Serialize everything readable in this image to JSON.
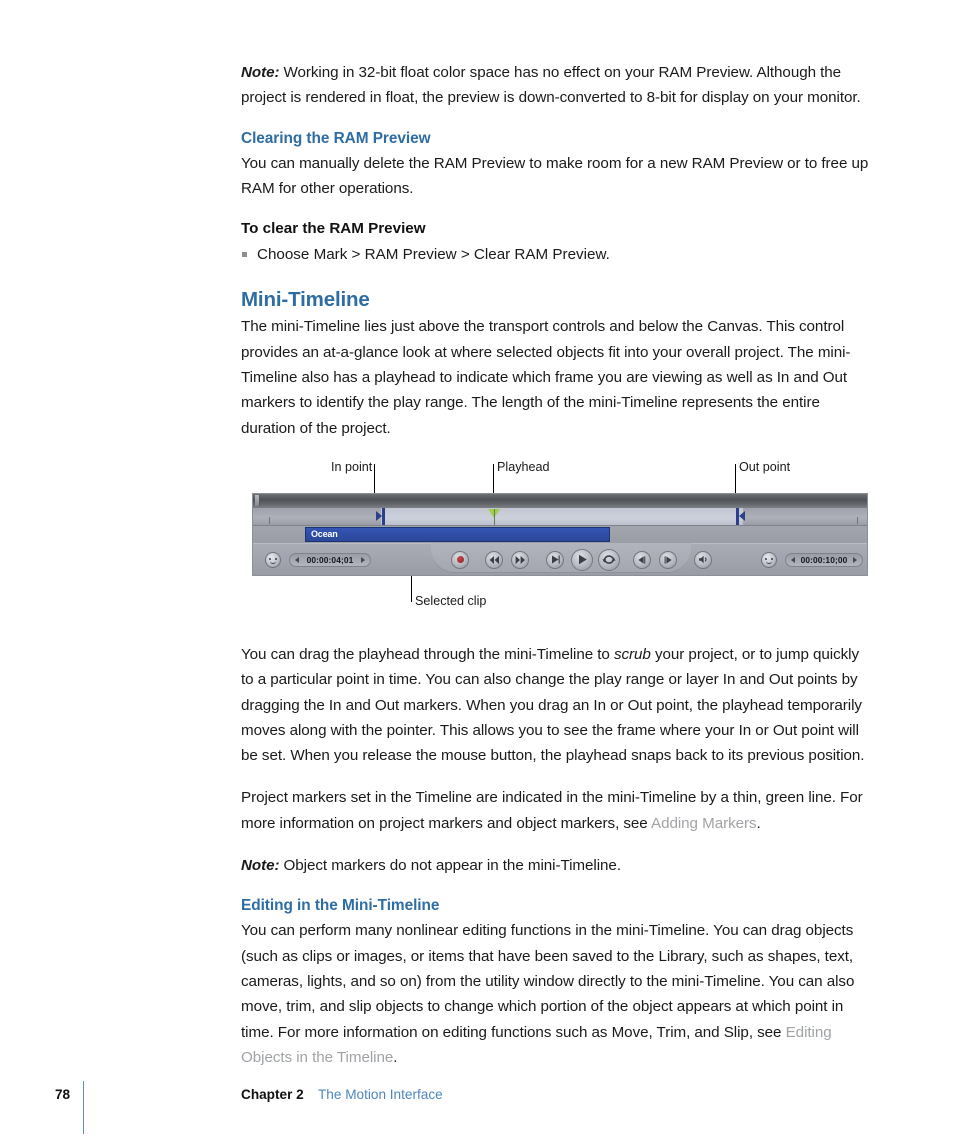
{
  "page": {
    "number": "78",
    "chapter_label": "Chapter 2",
    "chapter_title": "The Motion Interface"
  },
  "blocks": {
    "note1_label": "Note:",
    "note1_text": "Working in 32-bit float color space has no effect on your RAM Preview. Although the project is rendered in float, the preview is down-converted to 8-bit for display on your monitor.",
    "sub1_heading": "Clearing the RAM Preview",
    "sub1_text": "You can manually delete the RAM Preview to make room for a new RAM Preview or to free up RAM for other operations.",
    "proc1_heading": "To clear the RAM Preview",
    "proc1_step": "Choose Mark > RAM Preview > Clear RAM Preview.",
    "section_heading": "Mini-Timeline",
    "section_text": "The mini-Timeline lies just above the transport controls and below the Canvas. This control provides an at-a-glance look at where selected objects fit into your overall project. The mini-Timeline also has a playhead to indicate which frame you are viewing as well as In and Out markers to identify the play range. The length of the mini-Timeline represents the entire duration of the project.",
    "after_fig_p1_a": "You can drag the playhead through the mini-Timeline to ",
    "after_fig_p1_italic": "scrub",
    "after_fig_p1_b": " your project, or to jump quickly to a particular point in time. You can also change the play range or layer In and Out points by dragging the In and Out markers. When you drag an In or Out point, the playhead temporarily moves along with the pointer. This allows you to see the frame where your In or Out point will be set. When you release the mouse button, the playhead snaps back to its previous position.",
    "markers_p_a": "Project markers set in the Timeline are indicated in the mini-Timeline by a thin, green line. For more information on project markers and object markers, see ",
    "markers_p_link": "Adding Markers",
    "markers_p_b": ".",
    "note2_label": "Note:",
    "note2_text": "Object markers do not appear in the mini-Timeline.",
    "sub2_heading": "Editing in the Mini-Timeline",
    "sub2_text_a": "You can perform many nonlinear editing functions in the mini-Timeline. You can drag objects (such as clips or images, or items that have been saved to the Library, such as shapes, text, cameras, lights, and so on) from the utility window directly to the mini-Timeline. You can also move, trim, and slip objects to change which portion of the object appears at which point in time. For more information on editing functions such as Move, Trim, and Slip, see ",
    "sub2_text_link": "Editing Objects in the Timeline",
    "sub2_text_b": "."
  },
  "figure": {
    "callouts": {
      "in_point": "In point",
      "playhead": "Playhead",
      "out_point": "Out point",
      "selected_clip": "Selected clip"
    },
    "clip_name": "Ocean",
    "timecode_left": "00:00:04;01",
    "timecode_right": "00:00:10;00",
    "transport_buttons": [
      "record-button",
      "go-to-start-button",
      "go-to-end-button",
      "play-backward-button",
      "play-button",
      "loop-playback-button",
      "step-backward-button",
      "step-forward-button",
      "audio-button"
    ],
    "colors": {
      "clip": "#2f4ea8",
      "marker": "#2b3f8c",
      "playhead": "#9bd14a",
      "chrome": "#a7aab2"
    }
  }
}
